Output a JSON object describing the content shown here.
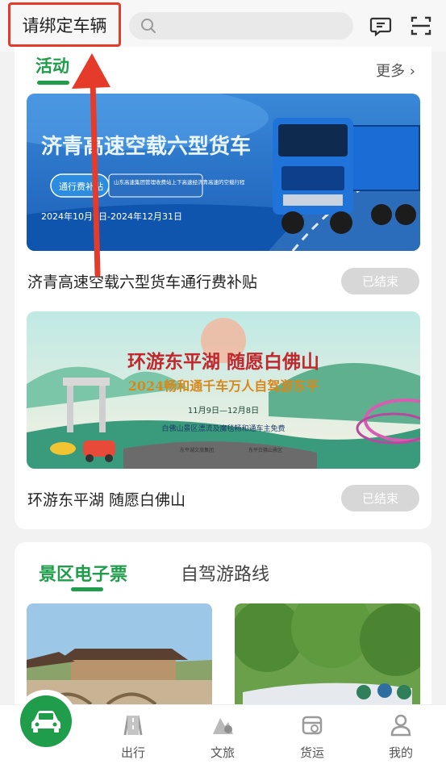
{
  "header": {
    "bind_vehicle_label": "请绑定车辆",
    "search_placeholder": ""
  },
  "activities": {
    "title": "活动",
    "more_label": "更多 ›",
    "items": [
      {
        "title": "济青高速空载六型货车通行费补贴",
        "status": "已结束",
        "banner": {
          "headline": "济青高速空载六型货车",
          "sub_button": "通行费补贴",
          "note": "山东高速集团管理收费站上下高速经济青高速的空载行程",
          "date_range": "2024年10月9日-2024年12月31日"
        }
      },
      {
        "title": "环游东平湖 随愿白佛山",
        "status": "已结束",
        "banner": {
          "headline": "环游东平湖  随愿白佛山",
          "subheadline": "2024畅和通千车万人自驾游东平",
          "date_range": "11月9日—12月8日",
          "note": "白佛山景区漂流及魔毯畅和通车主免费",
          "sponsor1": "东平湖文旅集团",
          "sponsor2": "东平白佛山景区"
        }
      }
    ]
  },
  "tickets": {
    "tab_active": "景区电子票",
    "tab_inactive": "自驾游路线"
  },
  "bottom_nav": {
    "items": [
      {
        "label": "出行",
        "icon": "road-icon"
      },
      {
        "label": "文旅",
        "icon": "travel-icon"
      },
      {
        "label": "货运",
        "icon": "freight-icon"
      },
      {
        "label": "我的",
        "icon": "user-icon"
      }
    ]
  },
  "colors": {
    "brand_green": "#1f9d4a",
    "highlight_red": "#e53b2b",
    "disabled_gray": "#d7d7d7"
  }
}
